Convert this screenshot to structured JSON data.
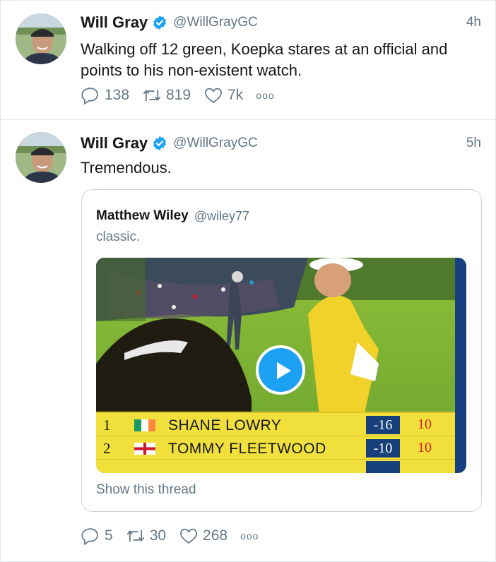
{
  "tweets": [
    {
      "name": "Will Gray",
      "handle": "@WillGrayGC",
      "time": "4h",
      "text": "Walking off 12 green, Koepka stares at an official and points to his non-existent watch.",
      "replies": "138",
      "retweets": "819",
      "likes": "7k",
      "more": "ooo"
    },
    {
      "name": "Will Gray",
      "handle": "@WillGrayGC",
      "time": "5h",
      "text": "Tremendous.",
      "replies": "5",
      "retweets": "30",
      "likes": "268",
      "more": "ooo",
      "quote": {
        "name": "Matthew Wiley",
        "handle": "@wiley77",
        "text": "classic.",
        "footer": "Show this thread",
        "scoreboard": [
          {
            "pos": "1",
            "name": "SHANE LOWRY",
            "score": "-16",
            "holes": "10"
          },
          {
            "pos": "2",
            "name": "TOMMY FLEETWOOD",
            "score": "-10",
            "holes": "10"
          }
        ]
      }
    }
  ],
  "colors": {
    "accent": "#1da1f2",
    "muted": "#657786",
    "border": "#e1e8ed",
    "text": "#14171a"
  },
  "icons": [
    "verified-badge-icon",
    "reply-icon",
    "retweet-icon",
    "like-icon",
    "more-icon",
    "play-icon",
    "ireland-flag-icon",
    "england-flag-icon"
  ]
}
